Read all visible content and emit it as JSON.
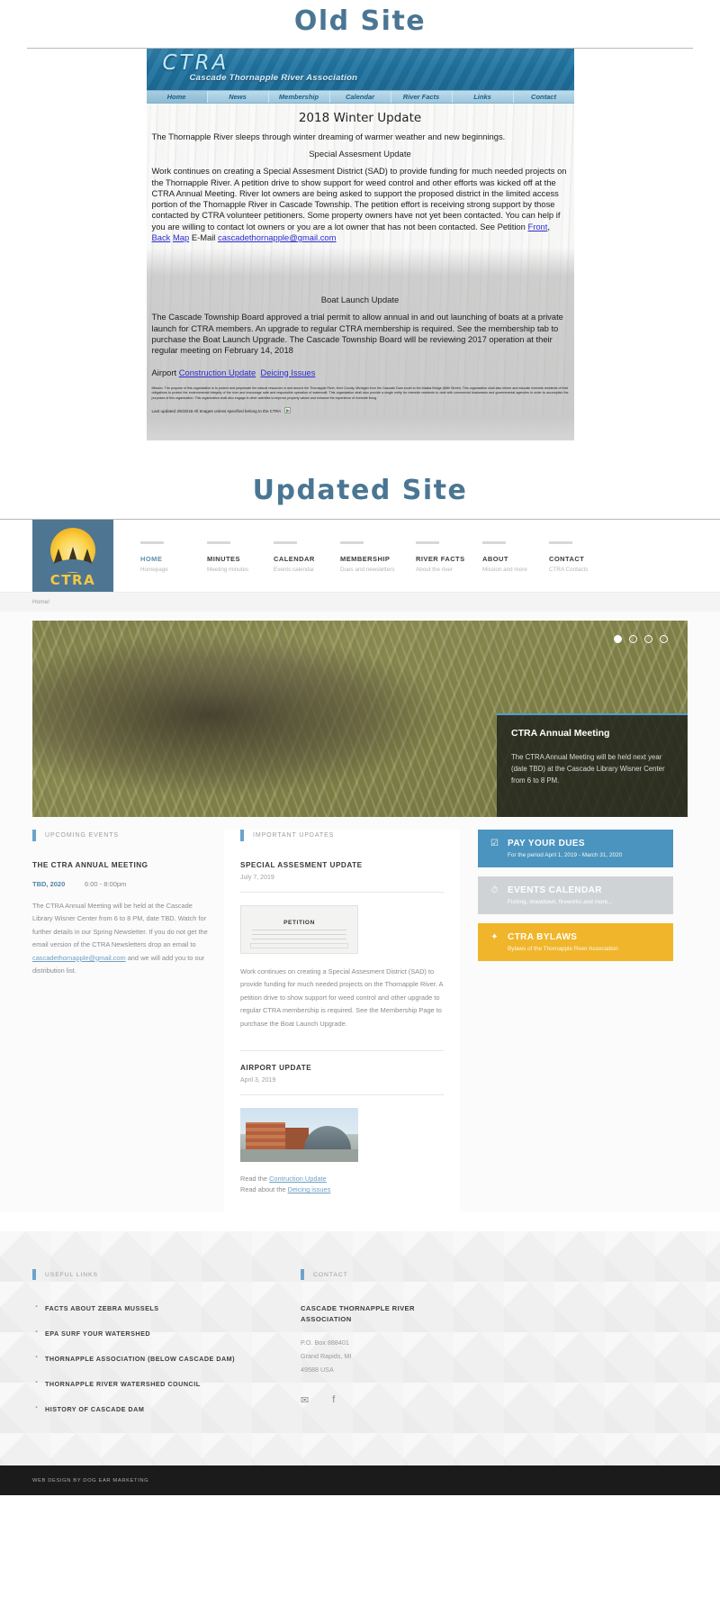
{
  "old_section": {
    "heading": "Old Site",
    "banner": {
      "logo": "CTRA",
      "tagline": "Cascade Thornapple River Association"
    },
    "nav": [
      "Home",
      "News",
      "Membership",
      "Calendar",
      "River Facts",
      "Links",
      "Contact"
    ],
    "active_nav": "Home",
    "page_title": "2018 Winter Update",
    "intro": "The Thornapple River sleeps through winter dreaming of warmer weather and new beginnings.",
    "subhead_1": "Special Assesment Update",
    "paragraph_1": "Work continues on creating a Special Assesment District (SAD) to provide funding for much needed projects on the Thornapple River. A petition drive to show support for weed control and other efforts was kicked off at the CTRA Annual Meeting. River lot owners are being asked to support the proposed district in the limited access portion of the Thornapple River in Cascade Township. The petition effort is receiving strong support by those contacted by CTRA volunteer petitioners. Some property owners have not yet been contacted. You can help if you are willing to contact lot owners or you are a lot owner that has not been contacted. See Petition",
    "link_front": "Front",
    "link_back": "Back",
    "link_map": "Map",
    "email_label": "E-Mail",
    "email": "cascadethornapple@gmail.com",
    "subhead_2": "Boat Launch Update",
    "paragraph_2": "The Cascade Township Board approved a trial permit to allow annual in and out launching of boats at a private launch for CTRA members. An upgrade to regular CTRA membership is required. See the membership tab to purchase the Boat Launch Upgrade. The Cascade Township Board will be reviewing 2017 operation at their regular meeting on February 14, 2018",
    "airport_label": "Airport",
    "airport_link_1": "Construction Update",
    "airport_link_2": "Deicing Issues",
    "mission": "Mission. The purpose of this organization is to protect and perpetuate the natural resources in and around the Thornapple River, Kent County, Michigan from the Cascade Dam south to the Alaska Bridge (68th Street). This organization shall also inform and educate riverside residents of their obligations to protect the environmental integrity of the river and encourage safe and responsible operation of watercraft. This organization shall also provide a single entity for riverside residents to deal with commercial businesses and governmental agencies in order to accomplish the purposes of this organization. This organization shall also engage in other activities to improve property values and enhance the experience of riverside living.",
    "last_updated": "Last updated 2/6/2018 All Images unless specified belong to the CTRA"
  },
  "updated_section": {
    "heading": "Updated Site"
  },
  "site": {
    "logo": {
      "text": "CTRA",
      "icon": "sunset-trees-logo"
    },
    "nav": [
      {
        "label": "HOME",
        "desc": "Homepage",
        "active": true
      },
      {
        "label": "MINUTES",
        "desc": "Meeting minutes",
        "active": false
      },
      {
        "label": "CALENDAR",
        "desc": "Events calendar",
        "active": false
      },
      {
        "label": "MEMBERSHIP",
        "desc": "Dues and newsletters",
        "active": false
      },
      {
        "label": "RIVER FACTS",
        "desc": "About the river",
        "active": false
      },
      {
        "label": "ABOUT",
        "desc": "Mission and more",
        "active": false
      },
      {
        "label": "CONTACT",
        "desc": "CTRA Contacts",
        "active": false
      }
    ],
    "breadcrumb": {
      "home": "Home",
      "separator": "/"
    },
    "hero": {
      "image_alt": "snapping-turtle-in-river",
      "dots": 4,
      "active_dot": 1,
      "card_title": "CTRA Annual Meeting",
      "card_text": "The CTRA Annual Meeting will be held next year (date TBD) at the Cascade Library Wisner Center from 6 to 8 PM."
    },
    "upcoming_events": {
      "kicker": "UPCOMING EVENTS",
      "title": "THE CTRA ANNUAL MEETING",
      "date": "TBD, 2020",
      "time": "6:00 - 8:00pm",
      "body_before_email": "The CTRA Annual Meeting will be held at the Cascade Library Wisner Center from 6 to 8 PM, date TBD. Watch for further details in our Spring Newsletter. If you do not get the email version of the CTRA Newsletters drop an email to ",
      "email": "cascadethornapple@gmail.com",
      "body_after_email": " and we will add you to our distribution list."
    },
    "important_updates": {
      "kicker": "IMPORTANT UPDATES",
      "items": [
        {
          "title": "SPECIAL ASSESMENT UPDATE",
          "date": "July 7, 2019",
          "thumb": "petition-document-thumbnail",
          "thumb_caption": "PETITION",
          "body": "Work continues on creating a Special Assesment District (SAD) to provide funding for much needed projects on the Thornapple River. A petition drive to show support for weed control and other upgrade to regular CTRA membership is required. See the Membership Page to purchase the Boat Launch Upgrade.",
          "link_text": "Membership Page"
        },
        {
          "title": "AIRPORT UPDATE",
          "date": "April 3, 2019",
          "thumb": "airport-terminal-photo",
          "read_1_prefix": "Read the ",
          "read_1_link": "Contruction Update",
          "read_2_prefix": "Read about the ",
          "read_2_link": "Deicing issues"
        }
      ]
    },
    "cta_buttons": [
      {
        "icon": "checkbox-icon",
        "title": "PAY YOUR DUES",
        "subtitle": "For the period April 1, 2019 - March 31, 2020",
        "color": "#4b94bf"
      },
      {
        "icon": "clock-icon",
        "title": "EVENTS CALENDAR",
        "subtitle": "Fishing, drawdown, fireworks and more...",
        "color": "#d0d3d6"
      },
      {
        "icon": "leaf-icon",
        "title": "CTRA BYLAWS",
        "subtitle": "Bylaws of the Thornapple River Association",
        "color": "#f0b52a"
      }
    ],
    "footer": {
      "links_kicker": "USEFUL LINKS",
      "links": [
        "FACTS ABOUT ZEBRA MUSSELS",
        "EPA SURF YOUR WATERSHED",
        "THORNAPPLE ASSOCIATION (BELOW CASCADE DAM)",
        "THORNAPPLE RIVER WATERSHED COUNCIL",
        "HISTORY OF CASCADE DAM"
      ],
      "contact_kicker": "CONTACT",
      "org_name": "CASCADE THORNAPPLE RIVER ASSOCIATION",
      "address_line_1": "P.O. Box 888401",
      "address_line_2": "Grand Rapids, MI",
      "address_line_3": "49588 USA",
      "social": [
        {
          "icon": "email-icon",
          "glyph": "✉"
        },
        {
          "icon": "facebook-icon",
          "glyph": "f"
        }
      ]
    },
    "bottom_bar": {
      "text": "WEB DESIGN BY DOG EAR MARKETING"
    }
  }
}
